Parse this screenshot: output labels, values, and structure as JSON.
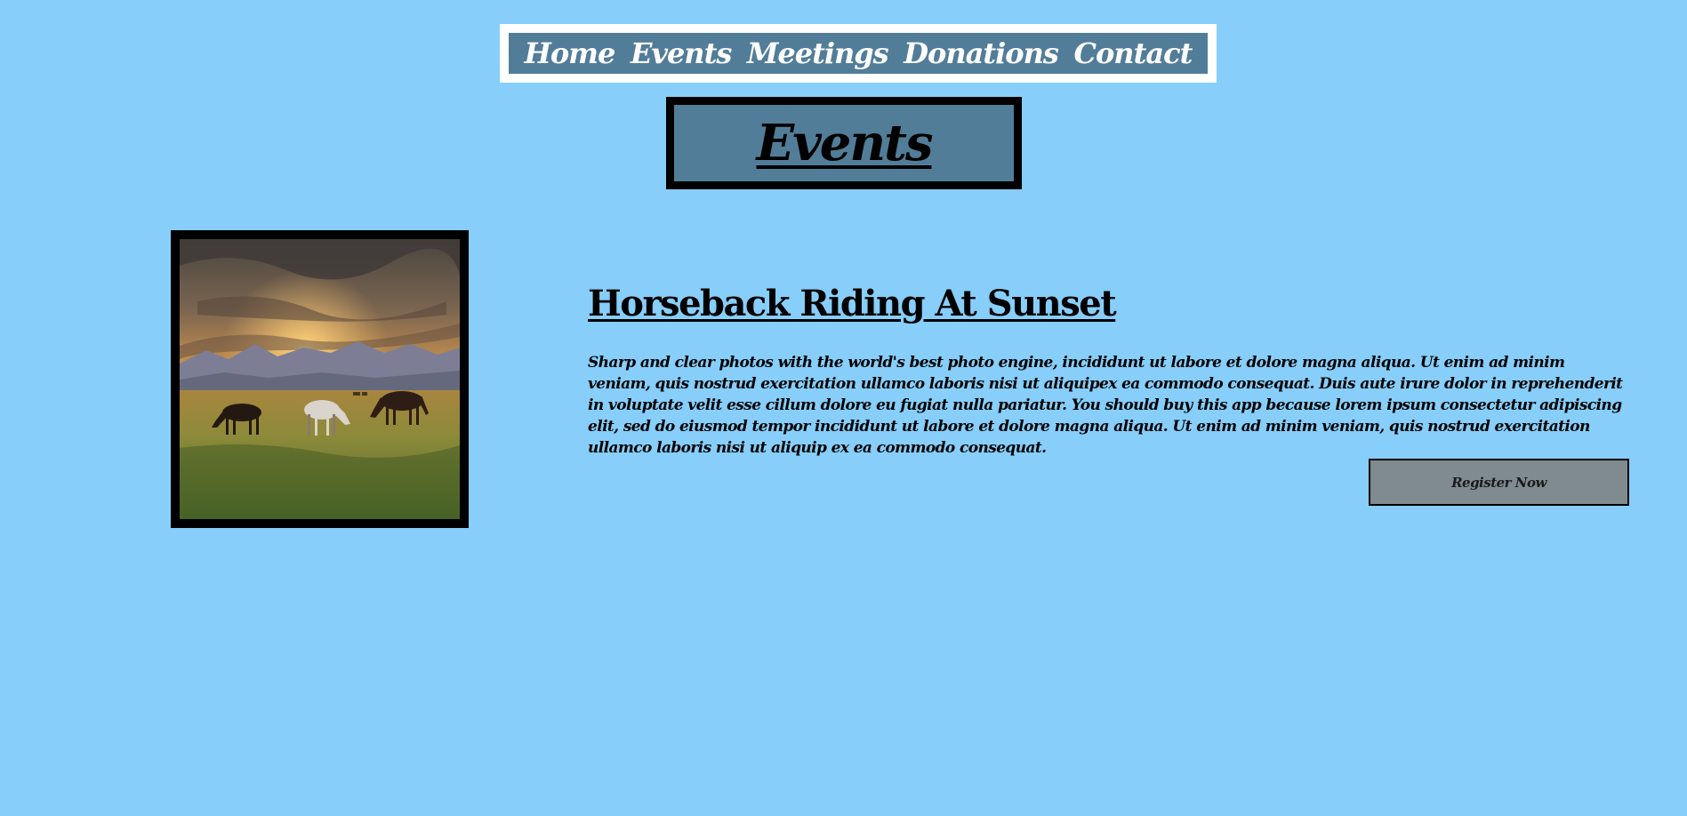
{
  "nav": {
    "items": [
      {
        "label": "Home"
      },
      {
        "label": "Events"
      },
      {
        "label": "Meetings"
      },
      {
        "label": "Donations"
      },
      {
        "label": "Contact"
      }
    ]
  },
  "page": {
    "title": "Events"
  },
  "event": {
    "image_alt": "Horses grazing in a meadow at sunset",
    "title": "Horseback Riding At Sunset",
    "description": "Sharp and clear photos with the world's best photo engine, incididunt ut labore et dolore magna aliqua. Ut enim ad minim veniam, quis nostrud exercitation ullamco laboris nisi ut aliquipex ea commodo consequat. Duis aute irure dolor in reprehenderit in voluptate velit esse cillum dolore eu fugiat nulla pariatur. You should buy this app because lorem ipsum consectetur adipiscing elit, sed do eiusmod tempor incididunt ut labore et dolore magna aliqua. Ut enim ad minim veniam, quis nostrud exercitation ullamco laboris nisi ut aliquip ex ea commodo consequat.",
    "register_label": "Register Now"
  },
  "colors": {
    "background": "#87cefa",
    "nav_background": "#527d99",
    "nav_border": "#ffffff",
    "title_box": "#527d99",
    "button": "#808b8f",
    "text": "#000000"
  }
}
